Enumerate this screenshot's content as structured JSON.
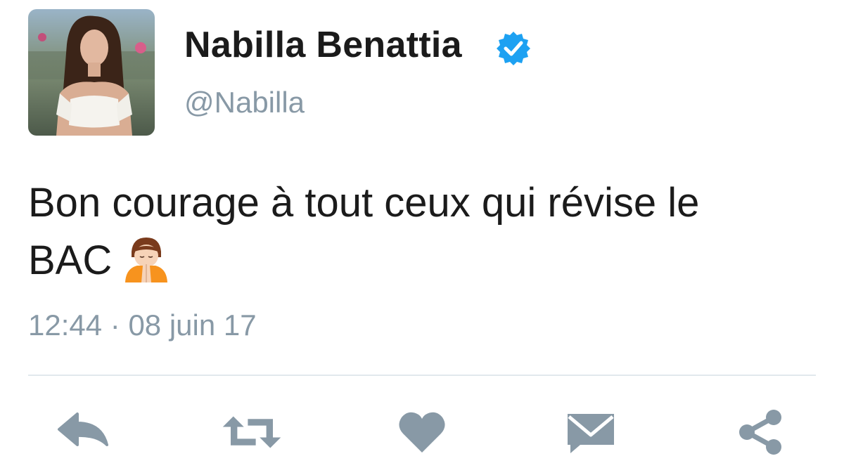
{
  "user": {
    "name": "Nabilla Benattia",
    "handle": "@Nabilla",
    "verified": true,
    "avatar_icon": "profile-photo"
  },
  "tweet": {
    "text_line1": "Bon courage à tout ceux qui révise le",
    "text_line2": "BAC",
    "emoji": "person-with-folded-hands-emoji",
    "time": "12:44",
    "separator": "·",
    "date": "08 juin 17"
  },
  "actions": [
    {
      "icon": "reply-icon"
    },
    {
      "icon": "retweet-icon"
    },
    {
      "icon": "heart-icon"
    },
    {
      "icon": "message-icon"
    },
    {
      "icon": "share-icon"
    }
  ],
  "colors": {
    "text": "#1b1b1b",
    "secondary": "#8899a6",
    "verified": "#1da1f2",
    "icon": "#8899a6",
    "divider": "#e1e8ed"
  }
}
